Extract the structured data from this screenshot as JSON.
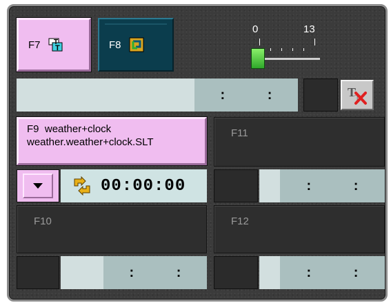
{
  "buttons": {
    "f7": {
      "label": "F7",
      "icon": "text-layers-icon"
    },
    "f8": {
      "label": "F8",
      "icon": "loop-icon"
    }
  },
  "slider": {
    "min_label": "0",
    "max_label": "13",
    "value": 0
  },
  "top_timecode": {
    "value": ":  :"
  },
  "clear_button": {
    "icon": "clear-text-icon"
  },
  "slots": {
    "f9": {
      "key": "F9",
      "name": "weather+clock",
      "file": "weather.weather+clock.SLT",
      "timecode": "00:00:00",
      "dropdown_icon": "chevron-down-icon",
      "repeat_icon": "repeat-icon"
    },
    "f10": {
      "key": "F10",
      "timecode": ":  :"
    },
    "f11": {
      "key": "F11",
      "timecode": ":  :"
    },
    "f12": {
      "key": "F12",
      "timecode": ":  :"
    }
  },
  "colors": {
    "panel": "#3b3b3b",
    "pink": "#f0bdf0",
    "teal": "#0b3d4d",
    "timecode_bg": "#aabfbf",
    "slider_thumb": "#5ad048"
  }
}
